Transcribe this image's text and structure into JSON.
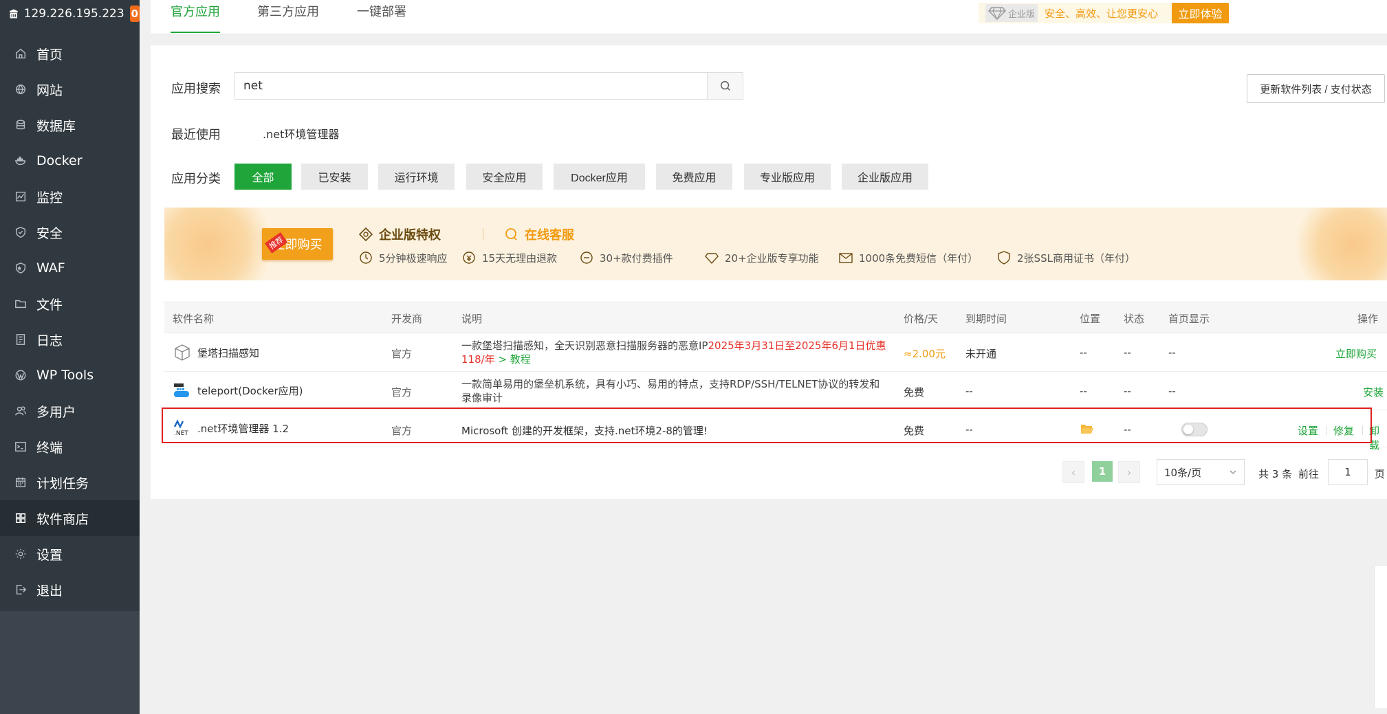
{
  "sidebar": {
    "ip": "129.226.195.223",
    "badge": "0",
    "items": [
      {
        "label": "首页",
        "icon": "home-icon"
      },
      {
        "label": "网站",
        "icon": "globe-icon"
      },
      {
        "label": "数据库",
        "icon": "database-icon"
      },
      {
        "label": "Docker",
        "icon": "docker-icon"
      },
      {
        "label": "监控",
        "icon": "monitor-chart-icon"
      },
      {
        "label": "安全",
        "icon": "shield-icon"
      },
      {
        "label": "WAF",
        "icon": "waf-shield-icon"
      },
      {
        "label": "文件",
        "icon": "folder-icon"
      },
      {
        "label": "日志",
        "icon": "log-icon"
      },
      {
        "label": "WP Tools",
        "icon": "wordpress-icon"
      },
      {
        "label": "多用户",
        "icon": "users-icon"
      },
      {
        "label": "终端",
        "icon": "terminal-icon"
      },
      {
        "label": "计划任务",
        "icon": "calendar-icon"
      },
      {
        "label": "软件商店",
        "icon": "grid-icon"
      },
      {
        "label": "设置",
        "icon": "gear-icon"
      },
      {
        "label": "退出",
        "icon": "logout-icon"
      }
    ],
    "active_index": 13
  },
  "topbar": {
    "tabs": [
      "官方应用",
      "第三方应用",
      "一键部署"
    ],
    "enterprise_badge": "企业版",
    "slogan": "安全、高效、让您更安心",
    "try_button": "立即体验"
  },
  "search": {
    "label": "应用搜索",
    "value": "net",
    "update_button": "更新软件列表 / 支付状态"
  },
  "recent": {
    "label": "最近使用",
    "item": ".net环境管理器"
  },
  "categories": {
    "label": "应用分类",
    "items": [
      "全部",
      "已安装",
      "运行环境",
      "安全应用",
      "Docker应用",
      "免费应用",
      "专业版应用",
      "企业版应用"
    ]
  },
  "banner": {
    "buy_button": "立即购买",
    "recommend_tag": "推荐",
    "privilege_title": "企业版特权",
    "service_title": "在线客服",
    "features": [
      "5分钟极速响应",
      "15天无理由退款",
      "30+款付费插件",
      "20+企业版专享功能",
      "1000条免费短信（年付）",
      "2张SSL商用证书（年付）"
    ]
  },
  "table": {
    "headers": [
      "软件名称",
      "开发商",
      "说明",
      "价格/天",
      "到期时间",
      "位置",
      "状态",
      "首页显示",
      "操作"
    ],
    "rows": [
      {
        "name": "堡塔扫描感知",
        "vendor": "官方",
        "desc_plain": "一款堡塔扫描感知，全天识别恶意扫描服务器的恶意IP",
        "desc_red": "2025年3月31日至2025年6月1日优惠118/年",
        "desc_link": " > 教程",
        "price": "≈2.00元",
        "expire": "未开通",
        "location": "--",
        "status": "--",
        "home": "--",
        "action": "立即购买"
      },
      {
        "name": "teleport(Docker应用)",
        "vendor": "官方",
        "desc_plain": "一款简单易用的堡垒机系统，具有小巧、易用的特点，支持RDP/SSH/TELNET协议的转发和录像审计",
        "price": "免费",
        "expire": "--",
        "location": "--",
        "status": "--",
        "home": "--",
        "action": "安装"
      },
      {
        "name": ".net环境管理器 1.2",
        "vendor": "官方",
        "desc_plain": "Microsoft 创建的开发框架，支持.net环境2-8的管理!",
        "price": "免费",
        "expire": "--",
        "status": "--",
        "actions": [
          "设置",
          "修复",
          "卸载"
        ]
      }
    ]
  },
  "pagination": {
    "current": "1",
    "page_size": "10条/页",
    "total": "共 3 条",
    "goto_label": "前往",
    "goto_value": "1",
    "page_unit": "页"
  },
  "colors": {
    "accent": "#20a53a",
    "sidebar_bg": "#30393f",
    "warning": "#f19a0f",
    "danger": "#e6322a"
  }
}
